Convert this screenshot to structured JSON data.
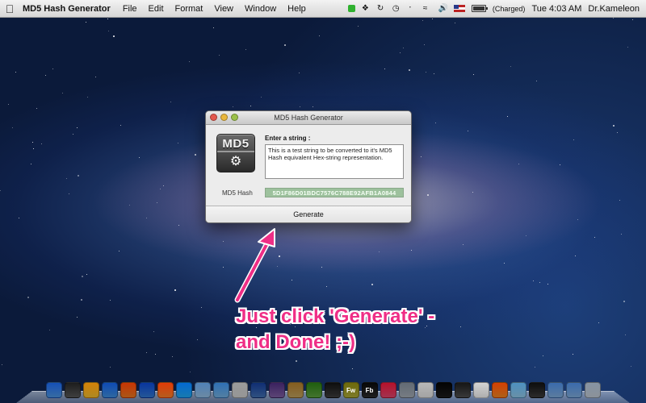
{
  "menubar": {
    "apple_icon": "apple-icon",
    "app_name": "MD5 Hash Generator",
    "menus": [
      "File",
      "Edit",
      "Format",
      "View",
      "Window",
      "Help"
    ],
    "battery_status": "(Charged)",
    "clock": "Tue 4:03 AM",
    "user": "Dr.Kameleon"
  },
  "window": {
    "title": "MD5 Hash Generator",
    "logo_text": "MD5",
    "input_label": "Enter a string :",
    "input_value": "This is a test string to be converted to it's MD5 Hash equivalent Hex-string representation.",
    "hash_label": "MD5 Hash",
    "hash_value": "5D1F86D01BDC7576C788E92AFB1A0844",
    "generate_label": "Generate"
  },
  "annotation": {
    "line1": "Just click 'Generate' -",
    "line2": "and Done! ;-)",
    "color": "#ef2e86"
  },
  "colors": {
    "hash_field_bg": "#9dc19d",
    "status_green": "#2fb12f"
  },
  "dock": {
    "icons": [
      {
        "name": "finder-icon",
        "color": "#4a8fd8",
        "glyph": ""
      },
      {
        "name": "launchpad-icon",
        "color": "#555555",
        "glyph": ""
      },
      {
        "name": "chrome-icon",
        "color": "#e8b62e",
        "glyph": ""
      },
      {
        "name": "safari-icon",
        "color": "#3d8ad6",
        "glyph": ""
      },
      {
        "name": "firefox-icon",
        "color": "#e2741f",
        "glyph": ""
      },
      {
        "name": "app-store-icon",
        "color": "#2f74c9",
        "glyph": ""
      },
      {
        "name": "xampp-icon",
        "color": "#f07b28",
        "glyph": ""
      },
      {
        "name": "skype-icon",
        "color": "#1fa3e8",
        "glyph": ""
      },
      {
        "name": "mail-icon",
        "color": "#8fb6d9",
        "glyph": ""
      },
      {
        "name": "cube-icon",
        "color": "#6ea9d7",
        "glyph": ""
      },
      {
        "name": "textedit-icon",
        "color": "#c7c7c7",
        "glyph": ""
      },
      {
        "name": "xcode-icon",
        "color": "#3f6cab",
        "glyph": ""
      },
      {
        "name": "preview-icon",
        "color": "#7a5b9c",
        "glyph": ""
      },
      {
        "name": "sketch-icon",
        "color": "#b89a5a",
        "glyph": ""
      },
      {
        "name": "coda-icon",
        "color": "#5a9b3d",
        "glyph": ""
      },
      {
        "name": "photoshop-icon",
        "color": "#3b3b3b",
        "glyph": ""
      },
      {
        "name": "fireworks-icon",
        "color": "#a7a436",
        "glyph": "Fw"
      },
      {
        "name": "flash-builder-icon",
        "color": "#2a2a2a",
        "glyph": "Fb"
      },
      {
        "name": "itunes-icon",
        "color": "#d8436a",
        "glyph": ""
      },
      {
        "name": "photo-icon",
        "color": "#9ea5ad",
        "glyph": ""
      },
      {
        "name": "activity-monitor-icon",
        "color": "#d9d9d9",
        "glyph": ""
      },
      {
        "name": "terminal-icon",
        "color": "#1a1a1a",
        "glyph": ""
      },
      {
        "name": "console-icon",
        "color": "#4b4b4b",
        "glyph": ""
      },
      {
        "name": "document-icon",
        "color": "#e8e8e8",
        "glyph": ""
      },
      {
        "name": "vlc-icon",
        "color": "#e8801f",
        "glyph": ""
      },
      {
        "name": "cube2-icon",
        "color": "#8cc0de",
        "glyph": ""
      },
      {
        "name": "md5-app-icon",
        "color": "#3a3a3a",
        "glyph": ""
      },
      {
        "name": "folder-icon",
        "color": "#7aa5d2",
        "glyph": ""
      },
      {
        "name": "downloads-folder-icon",
        "color": "#7aa5d2",
        "glyph": ""
      },
      {
        "name": "trash-icon",
        "color": "#b9c2cc",
        "glyph": ""
      }
    ]
  }
}
